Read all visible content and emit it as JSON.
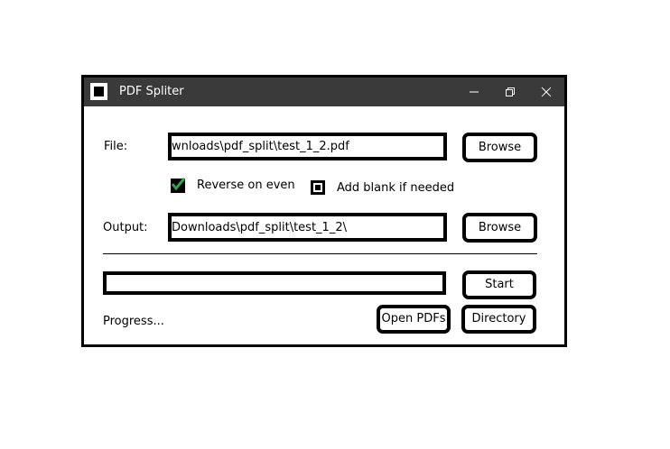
{
  "window": {
    "title": "PDF Spliter",
    "minimize_icon": "minimize-icon",
    "restore_icon": "restore-icon",
    "close_icon": "close-icon"
  },
  "file": {
    "label": "File:",
    "value": "wnloads\\pdf_split\\test_1_2.pdf",
    "browse_label": "Browse"
  },
  "options": {
    "reverse_label": "Reverse on even",
    "reverse_checked": true,
    "blank_label": "Add blank if needed",
    "blank_checked": false,
    "check_color": "#2ea44f"
  },
  "output": {
    "label": "Output:",
    "value": "\\Downloads\\pdf_split\\test_1_2",
    "browse_label": "Browse"
  },
  "actions": {
    "start_label": "Start",
    "open_pdfs_label": "Open PDFs",
    "directory_label": "Directory"
  },
  "progress": {
    "status_text": "Progress...",
    "value": 0
  }
}
